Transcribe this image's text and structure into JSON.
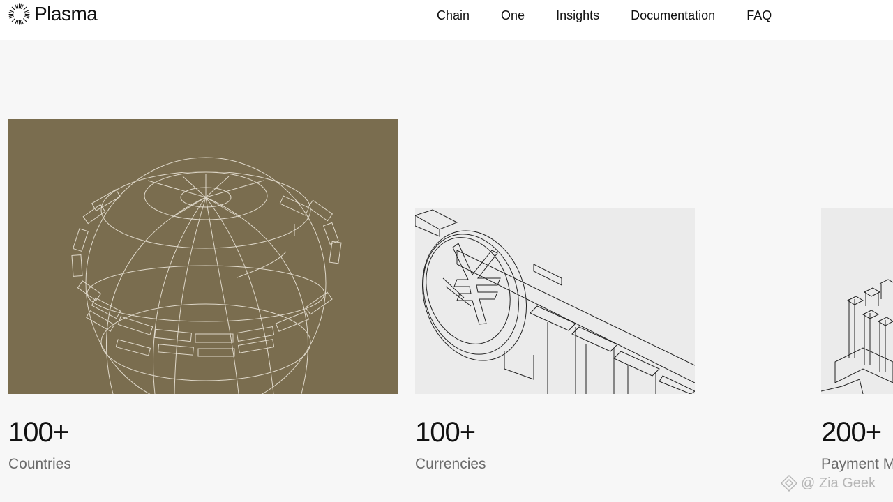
{
  "brand": {
    "name": "Plasma",
    "logo_icon": "radial-burst-icon"
  },
  "nav": {
    "items": [
      {
        "label": "Chain"
      },
      {
        "label": "One"
      },
      {
        "label": "Insights"
      },
      {
        "label": "Documentation"
      },
      {
        "label": "FAQ"
      }
    ]
  },
  "stats": [
    {
      "value": "100+",
      "label": "Countries",
      "illustration": "wireframe-globe-icon",
      "background": "#7a6d4f"
    },
    {
      "value": "100+",
      "label": "Currencies",
      "illustration": "yen-coin-icon",
      "background": "#ebebeb"
    },
    {
      "value": "200+",
      "label": "Payment M",
      "illustration": "payment-blocks-icon",
      "background": "#ebebeb"
    }
  ],
  "watermark": {
    "text": "@ Zia Geek"
  },
  "colors": {
    "page_bg": "#f7f7f7",
    "header_bg": "#ffffff",
    "globe_panel": "#7a6d4f",
    "light_panel": "#ebebeb"
  }
}
